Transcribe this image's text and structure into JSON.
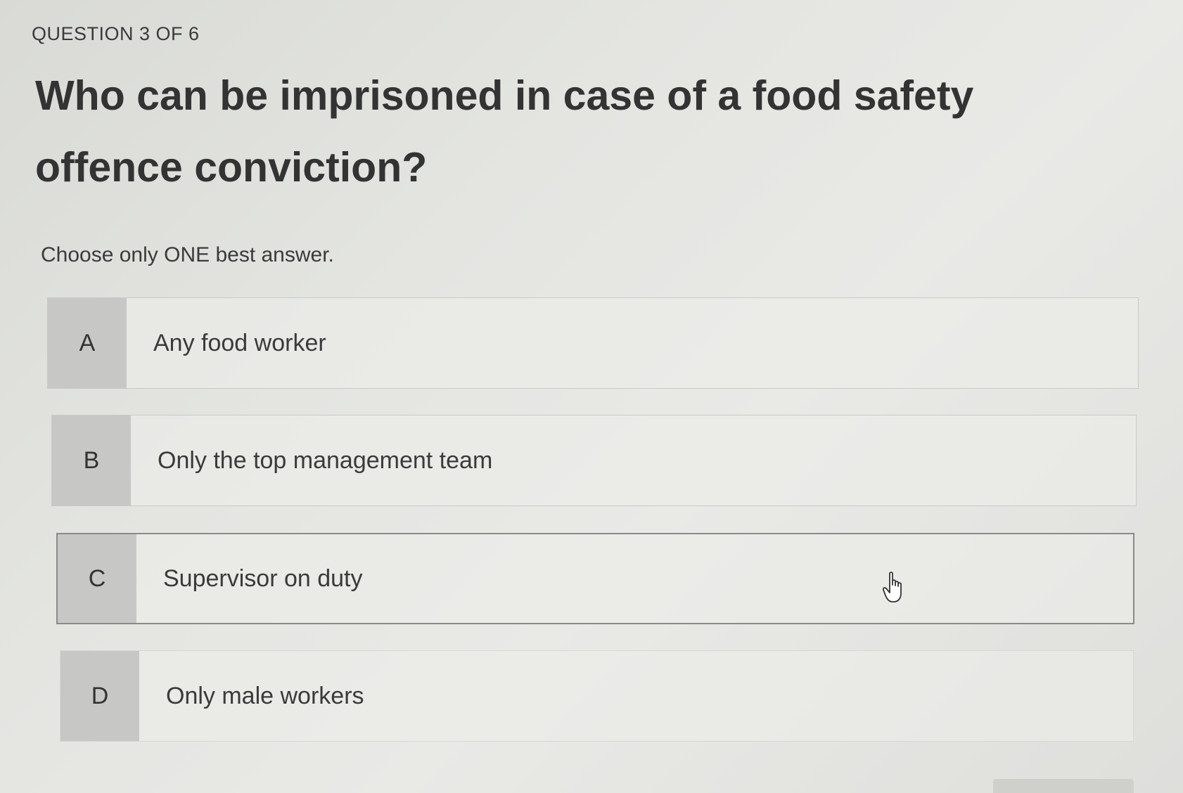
{
  "quiz": {
    "counter": "QUESTION 3 OF 6",
    "question": "Who can be imprisoned in case of a food safety offence conviction?",
    "instruction": "Choose only ONE best answer.",
    "options": [
      {
        "letter": "A",
        "text": "Any food worker"
      },
      {
        "letter": "B",
        "text": "Only the top management team"
      },
      {
        "letter": "C",
        "text": "Supervisor on duty"
      },
      {
        "letter": "D",
        "text": "Only male workers"
      }
    ]
  },
  "cursor": {
    "icon": "hand-pointer-icon"
  }
}
